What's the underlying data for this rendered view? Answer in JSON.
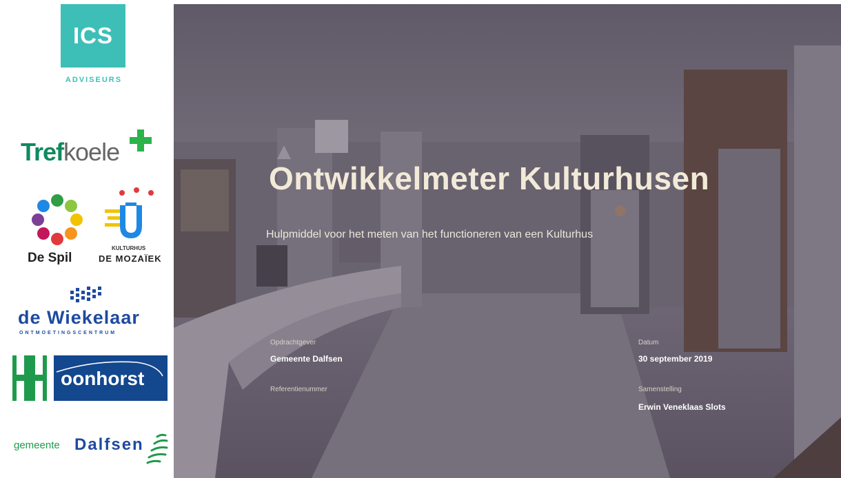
{
  "logos": {
    "ics": {
      "mark": "ICS",
      "sub": "ADVISEURS"
    },
    "trefkoele": {
      "part1": "Tref",
      "part2": "koele"
    },
    "despil": {
      "label": "De Spil"
    },
    "mozaiek": {
      "small": "KULTURHUS",
      "big": "DE MOZAÏEK"
    },
    "wiekelaar": {
      "name": "de Wiekelaar",
      "sub": "ONTMOETINGSCENTRUM"
    },
    "hoonhorst": {
      "name": "oonhorst"
    },
    "dalfsen": {
      "prefix": "gemeente",
      "name": "Dalfsen"
    }
  },
  "hero": {
    "title": "Ontwikkelmeter Kulturhusen",
    "subtitle": "Hulpmiddel voor het meten van het functioneren van een Kulturhus",
    "fields": {
      "client_label": "Opdrachtgever",
      "client_value": "Gemeente Dalfsen",
      "ref_label": "Referentienummer",
      "date_label": "Datum",
      "date_value": "30 september 2019",
      "author_label": "Samenstelling",
      "author_value": "Erwin Veneklaas Slots"
    },
    "scene_sign": "info"
  },
  "colors": {
    "ics_teal": "#3dbfb8",
    "green": "#1f9a4c",
    "blue": "#13478e",
    "title_cream": "#f2ead8"
  }
}
